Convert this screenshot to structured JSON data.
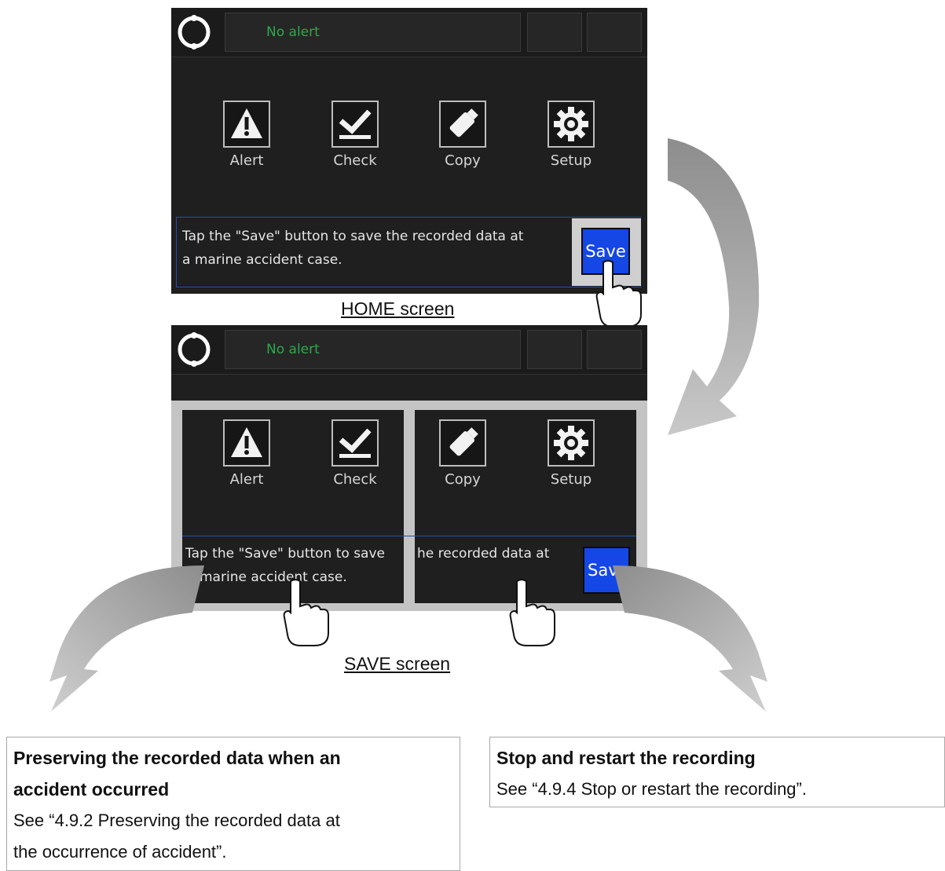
{
  "home_screen": {
    "status": "No alert",
    "icons": [
      {
        "label": "Alert",
        "icon": "alert-icon"
      },
      {
        "label": "Check",
        "icon": "check-icon"
      },
      {
        "label": "Copy",
        "icon": "usb-icon"
      },
      {
        "label": "Setup",
        "icon": "gear-icon"
      }
    ],
    "message_line1": "Tap the \"Save\" button to save the recorded data at",
    "message_line2": "a marine accident case.",
    "save_label": "Save",
    "caption": "HOME screen"
  },
  "save_screen": {
    "status": "No alert",
    "icons": [
      {
        "label": "Alert",
        "icon": "alert-icon"
      },
      {
        "label": "Check",
        "icon": "check-icon"
      },
      {
        "label": "Copy",
        "icon": "usb-icon"
      },
      {
        "label": "Setup",
        "icon": "gear-icon"
      }
    ],
    "left_message_line1": "Tap the \"Save\" button to save",
    "left_message_line2": "marine accident case.",
    "right_message_line1": "he recorded data at",
    "save_label": "Save",
    "caption": "SAVE screen"
  },
  "notes": {
    "left": {
      "title_line1": "Preserving the recorded data when an",
      "title_line2": "accident occurred",
      "text_line1": "See “4.9.2 Preserving the recorded data at",
      "text_line2": "the occurrence of accident”."
    },
    "right": {
      "title": "Stop and restart the recording",
      "text": "See “4.9.4 Stop or restart the recording”."
    }
  },
  "colors": {
    "status_green": "#2ea84c",
    "save_blue": "#1447e6",
    "arrow_gray": "#a8a8a8"
  }
}
